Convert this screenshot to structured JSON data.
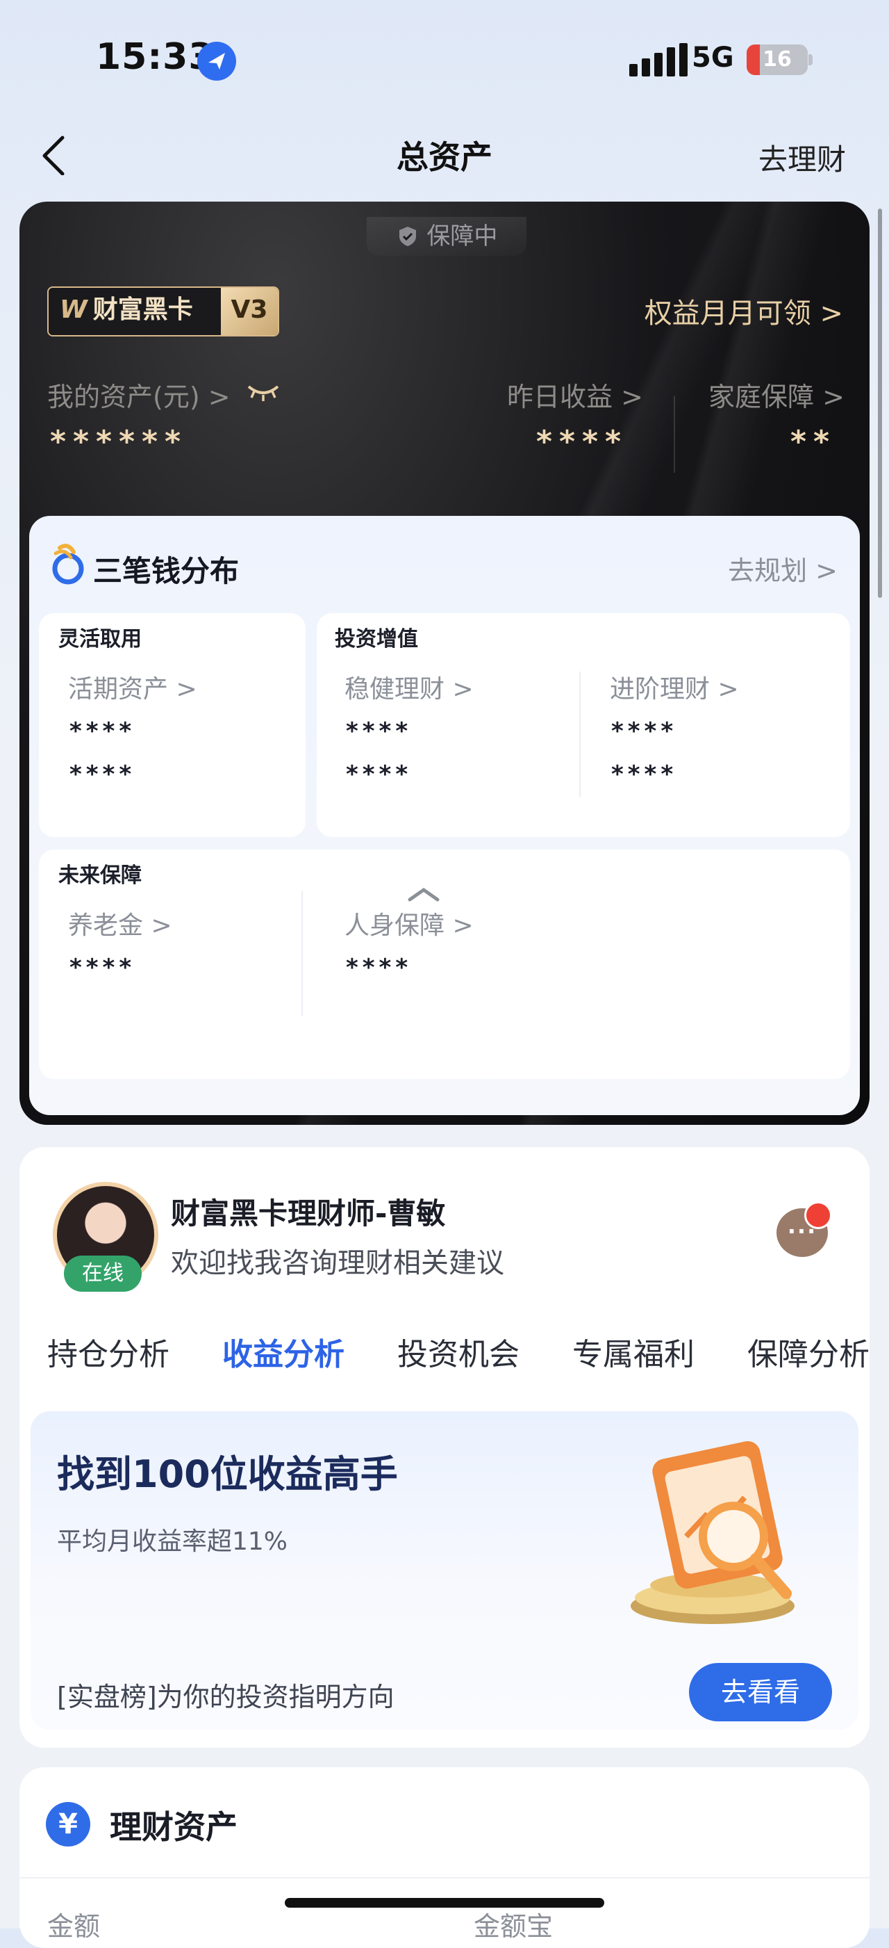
{
  "status_bar": {
    "time": "15:33",
    "network": "5G",
    "battery": "16",
    "battery_level": 0.16
  },
  "nav": {
    "title": "总资产",
    "right_action": "去理财",
    "back_icon": "chevron-left-icon"
  },
  "black_card": {
    "protect_label": "保障中",
    "badge": {
      "label": "财富黑卡",
      "level": "V3"
    },
    "rights_link": "权益月月可领 >",
    "my_assets": {
      "label": "我的资产(元) >",
      "value": "******"
    },
    "yesterday": {
      "label": "昨日收益 >",
      "value": "****"
    },
    "family": {
      "label": "家庭保障 >",
      "value": "**"
    }
  },
  "distribution": {
    "title": "三笔钱分布",
    "plan_link": "去规划 >",
    "flexible": {
      "title": "灵活取用",
      "items": [
        {
          "label": "活期资产 >",
          "v1": "****",
          "v2": "****"
        }
      ]
    },
    "investment": {
      "title": "投资增值",
      "items": [
        {
          "label": "稳健理财 >",
          "v1": "****",
          "v2": "****"
        },
        {
          "label": "进阶理财 >",
          "v1": "****",
          "v2": "****"
        }
      ]
    },
    "future": {
      "title": "未来保障",
      "items": [
        {
          "label": "养老金 >",
          "v1": "****"
        },
        {
          "label": "人身保障 >",
          "v1": "****"
        }
      ]
    }
  },
  "advisor": {
    "name": "财富黑卡理财师-曹敏",
    "subtitle": "欢迎找我咨询理财相关建议",
    "online": "在线",
    "tabs": [
      "持仓分析",
      "收益分析",
      "投资机会",
      "专属福利",
      "保障分析"
    ],
    "active_tab": 1
  },
  "promo": {
    "title": "找到100位收益高手",
    "subtitle": "平均月收益率超11%",
    "footer": "[实盘榜]为你的投资指明方向",
    "button": "去看看"
  },
  "finance": {
    "title": "理财资产",
    "icon": "¥",
    "col1": "金额",
    "col2": "金额宝"
  }
}
